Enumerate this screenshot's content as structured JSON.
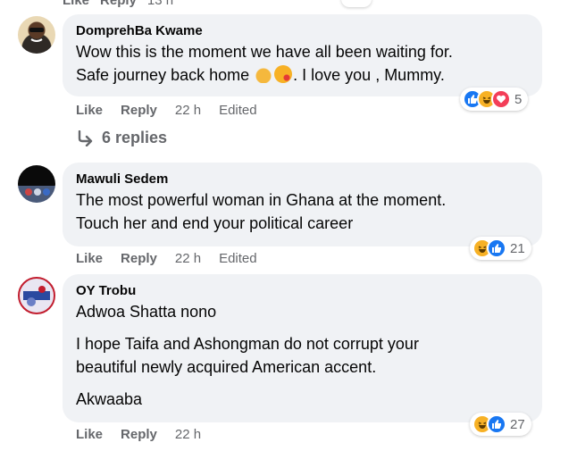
{
  "top": {
    "like_label": "Like",
    "reply_label": "Reply",
    "time": "13 h"
  },
  "comments": [
    {
      "author": "DomprehBa Kwame",
      "lines": [
        "Wow this is the moment we have all been waiting for.",
        "Safe journey back home",
        ". I love you , Mummy."
      ],
      "like_label": "Like",
      "reply_label": "Reply",
      "time": "22 h",
      "edited": "Edited",
      "reactions": [
        "like",
        "haha",
        "love"
      ],
      "reaction_count": "5",
      "replies": "6 replies"
    },
    {
      "author": "Mawuli Sedem",
      "lines": [
        "The most powerful woman in Ghana at the moment.",
        "Touch her and end your political career"
      ],
      "like_label": "Like",
      "reply_label": "Reply",
      "time": "22 h",
      "edited": "Edited",
      "reactions": [
        "haha",
        "like"
      ],
      "reaction_count": "21"
    },
    {
      "author": "OY Trobu",
      "lines": [
        "Adwoa Shatta nono",
        "I hope Taifa and Ashongman do not corrupt your",
        "beautiful newly acquired American accent.",
        "Akwaaba"
      ],
      "like_label": "Like",
      "reply_label": "Reply",
      "time": "22 h",
      "reactions": [
        "haha",
        "like"
      ],
      "reaction_count": "27"
    }
  ],
  "colors": {
    "bubble": "#f0f2f5",
    "muted": "#65676b",
    "like_blue": "#1877f2",
    "haha_yellow": "#f7b125",
    "love_red": "#f33e58"
  }
}
